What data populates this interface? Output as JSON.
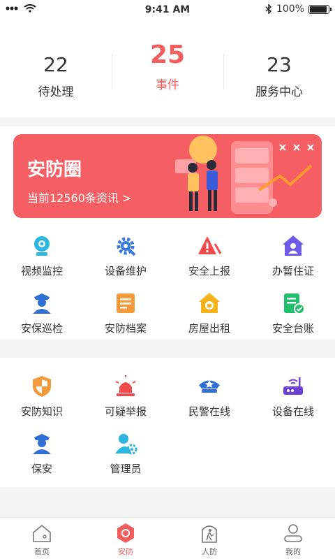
{
  "status_bar": {
    "time": "9:41 AM",
    "battery": "100%"
  },
  "stats": [
    {
      "value": "22",
      "label": "待处理"
    },
    {
      "value": "25",
      "label": "事件"
    },
    {
      "value": "23",
      "label": "服务中心"
    }
  ],
  "banner": {
    "title": "安防圈",
    "subtitle": "当前12560条资讯 >"
  },
  "grid1": [
    {
      "label": "视频监控",
      "icon": "camera-icon"
    },
    {
      "label": "设备维护",
      "icon": "gear-icon"
    },
    {
      "label": "安全上报",
      "icon": "warning-icon"
    },
    {
      "label": "办暂住证",
      "icon": "house-user-icon"
    },
    {
      "label": "安保巡检",
      "icon": "police-icon"
    },
    {
      "label": "安防档案",
      "icon": "archive-icon"
    },
    {
      "label": "房屋出租",
      "icon": "rent-house-icon"
    },
    {
      "label": "安全台账",
      "icon": "ledger-check-icon"
    }
  ],
  "grid2": [
    {
      "label": "安防知识",
      "icon": "shield-icon"
    },
    {
      "label": "可疑举报",
      "icon": "alarm-light-icon"
    },
    {
      "label": "民警在线",
      "icon": "police-cap-icon"
    },
    {
      "label": "设备在线",
      "icon": "router-icon"
    },
    {
      "label": "保安",
      "icon": "guard-icon"
    },
    {
      "label": "管理员",
      "icon": "admin-gear-icon"
    }
  ],
  "tabs": [
    {
      "label": "首页",
      "icon": "home-icon"
    },
    {
      "label": "安防",
      "icon": "security-hex-icon"
    },
    {
      "label": "人防",
      "icon": "runner-door-icon"
    },
    {
      "label": "我的",
      "icon": "profile-icon"
    }
  ],
  "colors": {
    "accent": "#f25d5d",
    "banner": "#f55f64"
  }
}
